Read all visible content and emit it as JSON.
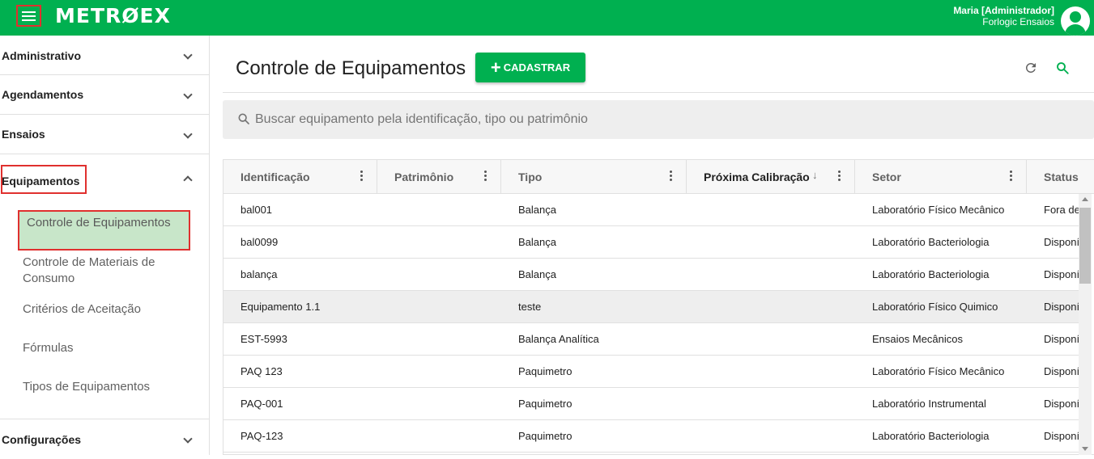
{
  "topbar": {
    "logo": "METRØEX",
    "user_name": "Maria [Administrador]",
    "user_company": "Forlogic Ensaios",
    "color": "#00b050"
  },
  "sidebar": {
    "sections": [
      {
        "label": "Administrativo",
        "expanded": false
      },
      {
        "label": "Agendamentos",
        "expanded": false
      },
      {
        "label": "Ensaios",
        "expanded": false
      },
      {
        "label": "Equipamentos",
        "expanded": true
      },
      {
        "label": "Configurações",
        "expanded": false
      }
    ],
    "equipamentos_items": [
      {
        "label": "Controle de Equipamentos",
        "active": true
      },
      {
        "label": "Controle de Materiais de Consumo",
        "active": false
      },
      {
        "label": "Critérios de Aceitação",
        "active": false
      },
      {
        "label": "Fórmulas",
        "active": false
      },
      {
        "label": "Tipos de Equipamentos",
        "active": false
      }
    ]
  },
  "main": {
    "title": "Controle de Equipamentos",
    "add_button": "CADASTRAR",
    "search_placeholder": "Buscar equipamento pela identificação, tipo ou patrimônio"
  },
  "table": {
    "columns": [
      "Identificação",
      "Patrimônio",
      "Tipo",
      "Próxima Calibração",
      "Setor",
      "Status"
    ],
    "sorted_column": "Próxima Calibração",
    "rows": [
      {
        "identificacao": "bal001",
        "patrimonio": "",
        "tipo": "Balança",
        "proxima_calibracao": "",
        "setor": "Laboratório Físico Mecânico",
        "status": "Fora de"
      },
      {
        "identificacao": "bal0099",
        "patrimonio": "",
        "tipo": "Balança",
        "proxima_calibracao": "",
        "setor": "Laboratório Bacteriologia",
        "status": "Disponí"
      },
      {
        "identificacao": "balança",
        "patrimonio": "",
        "tipo": "Balança",
        "proxima_calibracao": "",
        "setor": "Laboratório Bacteriologia",
        "status": "Disponí"
      },
      {
        "identificacao": "Equipamento 1.1",
        "patrimonio": "",
        "tipo": "teste",
        "proxima_calibracao": "",
        "setor": "Laboratório Físico Quimico",
        "status": "Disponí",
        "highlighted": true
      },
      {
        "identificacao": "EST-5993",
        "patrimonio": "",
        "tipo": "Balança Analítica",
        "proxima_calibracao": "",
        "setor": "Ensaios Mecânicos",
        "status": "Disponí"
      },
      {
        "identificacao": "PAQ 123",
        "patrimonio": "",
        "tipo": "Paquimetro",
        "proxima_calibracao": "",
        "setor": "Laboratório Físico Mecânico",
        "status": "Disponí"
      },
      {
        "identificacao": "PAQ-001",
        "patrimonio": "",
        "tipo": "Paquimetro",
        "proxima_calibracao": "",
        "setor": "Laboratório Instrumental",
        "status": "Disponí"
      },
      {
        "identificacao": "PAQ-123",
        "patrimonio": "",
        "tipo": "Paquimetro",
        "proxima_calibracao": "",
        "setor": "Laboratório Bacteriologia",
        "status": "Disponí"
      }
    ]
  }
}
